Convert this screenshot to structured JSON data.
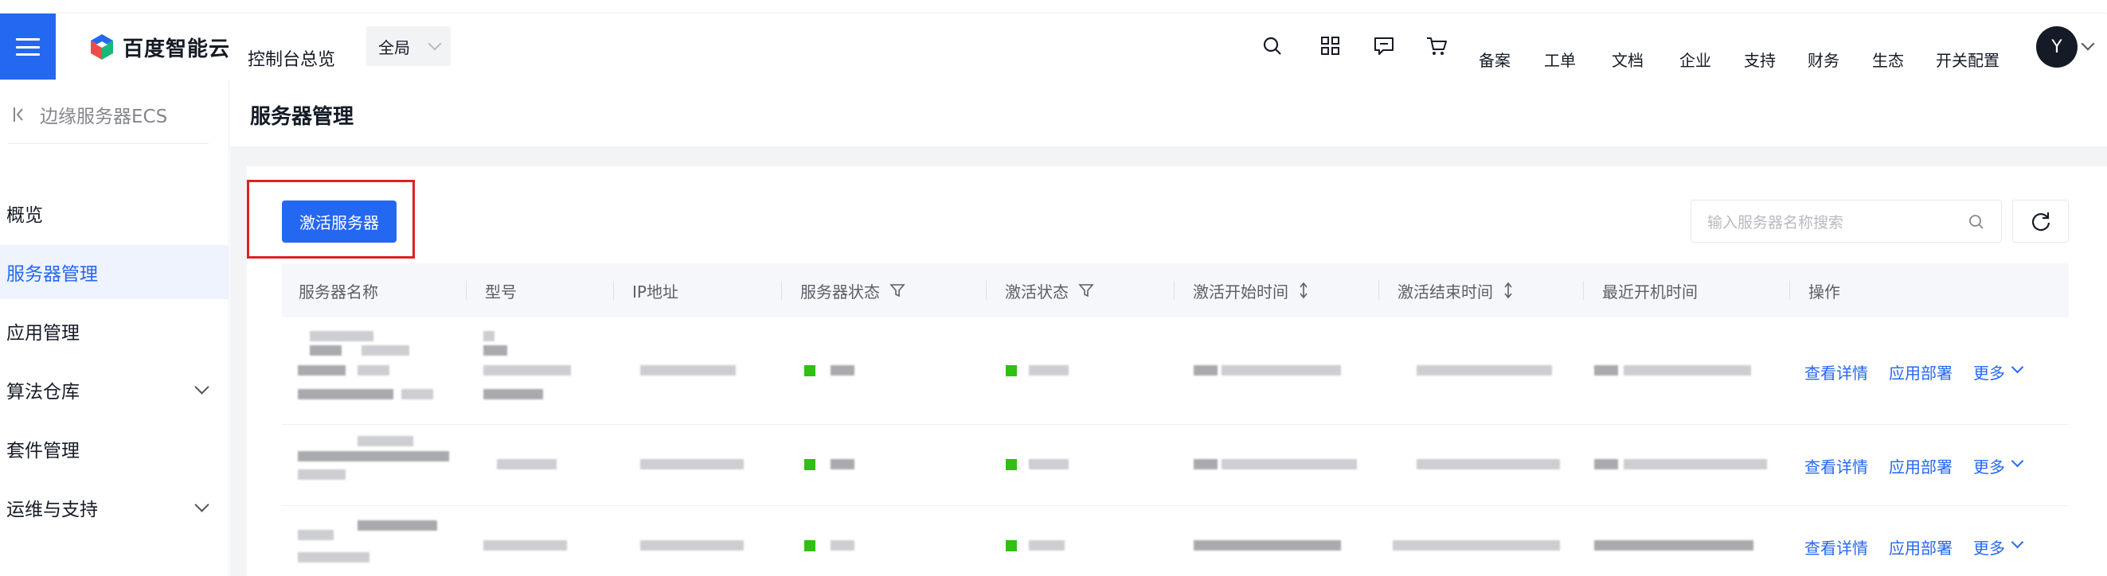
{
  "header": {
    "logo_text": "百度智能云",
    "console_title": "控制台总览",
    "scope": "全局",
    "icons": [
      "search-icon",
      "apps-grid-icon",
      "message-icon",
      "cart-icon"
    ],
    "nav": [
      "备案",
      "工单",
      "文档",
      "企业",
      "支持",
      "财务",
      "生态",
      "开关配置"
    ],
    "avatar_initial": "Y"
  },
  "sidebar": {
    "back_label": "边缘服务器ECS",
    "items": [
      {
        "label": "概览"
      },
      {
        "label": "服务器管理"
      },
      {
        "label": "应用管理"
      },
      {
        "label": "算法仓库"
      },
      {
        "label": "套件管理"
      },
      {
        "label": "运维与支持"
      }
    ]
  },
  "page": {
    "title": "服务器管理",
    "activate_button": "激活服务器",
    "search_placeholder": "输入服务器名称搜索"
  },
  "table": {
    "columns": [
      "服务器名称",
      "型号",
      "IP地址",
      "服务器状态",
      "激活状态",
      "激活开始时间",
      "激活结束时间",
      "最近开机时间",
      "操作"
    ],
    "row_actions": [
      "查看详情",
      "应用部署",
      "更多"
    ]
  },
  "colors": {
    "accent": "#2468f2",
    "status_green": "#30bf13",
    "highlight_red": "#e02020"
  }
}
